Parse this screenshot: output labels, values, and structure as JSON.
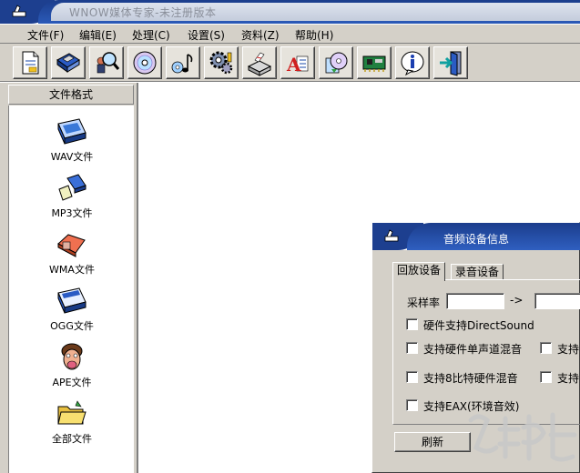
{
  "window": {
    "title": "WNOW媒体专家-未注册版本"
  },
  "menu": [
    {
      "label": "文件(F)"
    },
    {
      "label": "编辑(E)"
    },
    {
      "label": "处理(C)"
    },
    {
      "label": "设置(S)"
    },
    {
      "label": "资料(Z)"
    },
    {
      "label": "帮助(H)"
    }
  ],
  "toolbar": [
    {
      "icon": "document-icon"
    },
    {
      "icon": "floppy-save-icon"
    },
    {
      "icon": "magnifier-people-icon"
    },
    {
      "icon": "cd-disc-icon"
    },
    {
      "icon": "music-notes-icon"
    },
    {
      "icon": "gear-icon"
    },
    {
      "icon": "scanner-icon"
    },
    {
      "icon": "font-a-icon"
    },
    {
      "icon": "cd-box-icon"
    },
    {
      "icon": "circuit-board-icon"
    },
    {
      "icon": "info-icon"
    },
    {
      "icon": "exit-door-icon"
    }
  ],
  "left_panel": {
    "header": "文件格式",
    "items": [
      {
        "label": "WAV文件",
        "icon": "wav-file-icon"
      },
      {
        "label": "MP3文件",
        "icon": "mp3-file-icon"
      },
      {
        "label": "WMA文件",
        "icon": "wma-file-icon"
      },
      {
        "label": "OGG文件",
        "icon": "ogg-file-icon"
      },
      {
        "label": "APE文件",
        "icon": "ape-file-icon"
      },
      {
        "label": "全部文件",
        "icon": "folder-icon"
      }
    ]
  },
  "dialog": {
    "title": "音频设备信息",
    "tabs": [
      {
        "label": "回放设备",
        "active": true
      },
      {
        "label": "录音设备",
        "active": false
      }
    ],
    "sample_rate_label": "采样率",
    "sample_rate_arrow": "->",
    "sample_rate_from": "",
    "sample_rate_to": "",
    "checkboxes": [
      {
        "label": "硬件支持DirectSound",
        "checked": false
      },
      {
        "label": "支持硬件单声道混音",
        "checked": false
      },
      {
        "label": "支持",
        "checked": false
      },
      {
        "label": "支持8比特硬件混音",
        "checked": false
      },
      {
        "label": "支持",
        "checked": false
      },
      {
        "label": "支持EAX(环境音效)",
        "checked": false
      }
    ],
    "refresh_label": "刷新"
  }
}
